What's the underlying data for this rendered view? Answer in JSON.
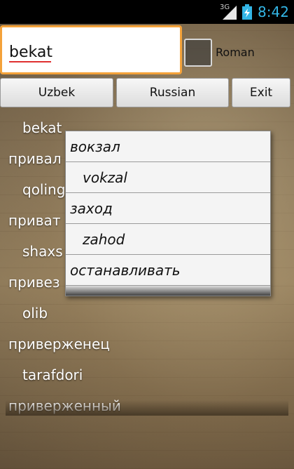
{
  "status_bar": {
    "network": "3G",
    "time": "8:42",
    "signal_icon": "signal-icon",
    "battery_icon": "battery-charging-icon"
  },
  "search": {
    "value": "bekat",
    "roman_label": "Roman",
    "roman_checked": false
  },
  "buttons": {
    "uzbek": "Uzbek",
    "russian": "Russian",
    "exit": "Exit"
  },
  "results": [
    {
      "text": "bekat",
      "kind": "indent"
    },
    {
      "text": "привал",
      "kind": "ru"
    },
    {
      "text": "qoling",
      "kind": "indent"
    },
    {
      "text": "приват",
      "kind": "ru"
    },
    {
      "text": "shaxs",
      "kind": "indent"
    },
    {
      "text": "привез",
      "kind": "ru"
    },
    {
      "text": "olib",
      "kind": "indent"
    },
    {
      "text": "приверженец",
      "kind": "ru"
    },
    {
      "text": "tarafdori",
      "kind": "indent"
    },
    {
      "text": "приверженный",
      "kind": "ru"
    }
  ],
  "popup": [
    {
      "text": "вокзал",
      "kind": "main"
    },
    {
      "text": "vokzal",
      "kind": "sub"
    },
    {
      "text": "заход",
      "kind": "main"
    },
    {
      "text": "zahod",
      "kind": "sub"
    },
    {
      "text": "останавливать",
      "kind": "main"
    }
  ],
  "colors": {
    "accent": "#33b5e5",
    "focus_border": "#f4a23a"
  }
}
